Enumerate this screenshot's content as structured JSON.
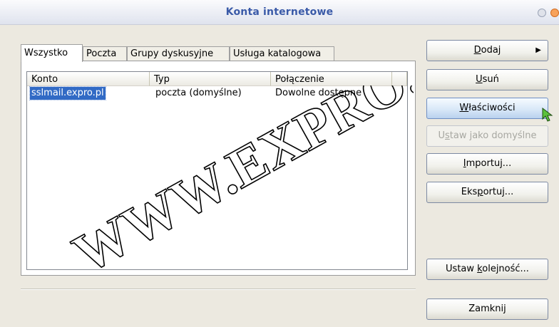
{
  "window": {
    "title": "Konta internetowe"
  },
  "tabs": [
    {
      "label": "Wszystko",
      "active": true
    },
    {
      "label": "Poczta",
      "active": false
    },
    {
      "label": "Grupy dyskusyjne",
      "active": false
    },
    {
      "label": "Usługa katalogowa",
      "active": false
    }
  ],
  "list": {
    "columns": [
      "Konto",
      "Typ",
      "Połączenie"
    ],
    "rows": [
      {
        "konto": "sslmail.expro.pl",
        "typ": "poczta (domyślne)",
        "polaczenie": "Dowolne dostępne",
        "selected": true
      }
    ]
  },
  "buttons": {
    "add": {
      "pre": "",
      "key": "D",
      "post": "odaj",
      "arrow": "▶"
    },
    "remove": {
      "pre": "",
      "key": "U",
      "post": "suń"
    },
    "properties": {
      "pre": "",
      "key": "W",
      "post": "łaściwości"
    },
    "set_default": {
      "pre": "U",
      "key": "s",
      "post": "taw jako domyślne",
      "disabled": true
    },
    "import": {
      "pre": "",
      "key": "I",
      "post": "mportuj..."
    },
    "export": {
      "pre": "Eks",
      "key": "p",
      "post": "ortuj..."
    },
    "order": {
      "pre": "Ustaw ",
      "key": "k",
      "post": "olejność..."
    },
    "close": {
      "label": "Zamknij"
    }
  },
  "watermark": {
    "text": "WWW.EXPRO.PL",
    "color": "#000000"
  },
  "colors": {
    "selection": "#316ac5",
    "title": "#3a5aa8",
    "hover": "#b9d1ee"
  }
}
